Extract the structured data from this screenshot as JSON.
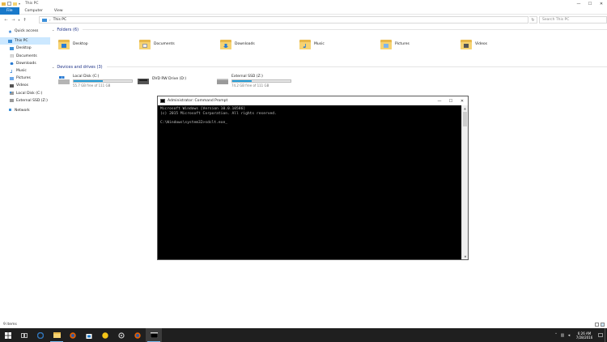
{
  "titlebar": {
    "title": "This PC",
    "minimize": "—",
    "maximize": "☐",
    "close": "✕"
  },
  "ribbon": {
    "tabs": [
      "File",
      "Computer",
      "View"
    ]
  },
  "address": {
    "back": "←",
    "forward": "→",
    "up": "↑",
    "path": "This PC",
    "refresh": "↻",
    "search_placeholder": "Search This PC"
  },
  "sidebar": {
    "items": [
      {
        "label": "Quick access",
        "icon": "star-icon"
      },
      {
        "label": "This PC",
        "icon": "computer-icon"
      },
      {
        "label": "Desktop",
        "icon": "desktop-icon"
      },
      {
        "label": "Documents",
        "icon": "documents-icon"
      },
      {
        "label": "Downloads",
        "icon": "download-icon"
      },
      {
        "label": "Music",
        "icon": "music-icon"
      },
      {
        "label": "Pictures",
        "icon": "pictures-icon"
      },
      {
        "label": "Videos",
        "icon": "videos-icon"
      },
      {
        "label": "Local Disk (C:)",
        "icon": "drive-icon"
      },
      {
        "label": "External SSD (Z:)",
        "icon": "drive-icon"
      },
      {
        "label": "Network",
        "icon": "network-icon"
      }
    ]
  },
  "folders": {
    "header": "Folders (6)",
    "items": [
      "Desktop",
      "Documents",
      "Downloads",
      "Music",
      "Pictures",
      "Videos"
    ]
  },
  "drives": {
    "header": "Devices and drives (3)",
    "items": [
      {
        "name": "Local Disk (C:)",
        "free": "55.7 GB free of 111 GB",
        "used_fraction": 0.5
      },
      {
        "name": "DVD RW Drive (D:)",
        "free": "",
        "used_fraction": null
      },
      {
        "name": "External SSD (Z:)",
        "free": "74.2 GB free of 111 GB",
        "used_fraction": 0.33
      }
    ]
  },
  "statusbar": {
    "count": "9 items"
  },
  "cmd": {
    "title": "Administrator: Command Prompt",
    "minimize": "—",
    "maximize": "☐",
    "close": "✕",
    "lines": [
      "Microsoft Windows [Version 10.0.10586]",
      "(c) 2015 Microsoft Corporation. All rights reserved.",
      "",
      "C:\\Windows\\system32>sdclt.exe_"
    ]
  },
  "taskbar": {
    "time": "6:26 AM",
    "date": "7/28/2016"
  },
  "colors": {
    "accent": "#1979ca",
    "selection": "#cce8ff",
    "drive_bar": "#26a0da",
    "taskbar": "#1f1f1f"
  }
}
